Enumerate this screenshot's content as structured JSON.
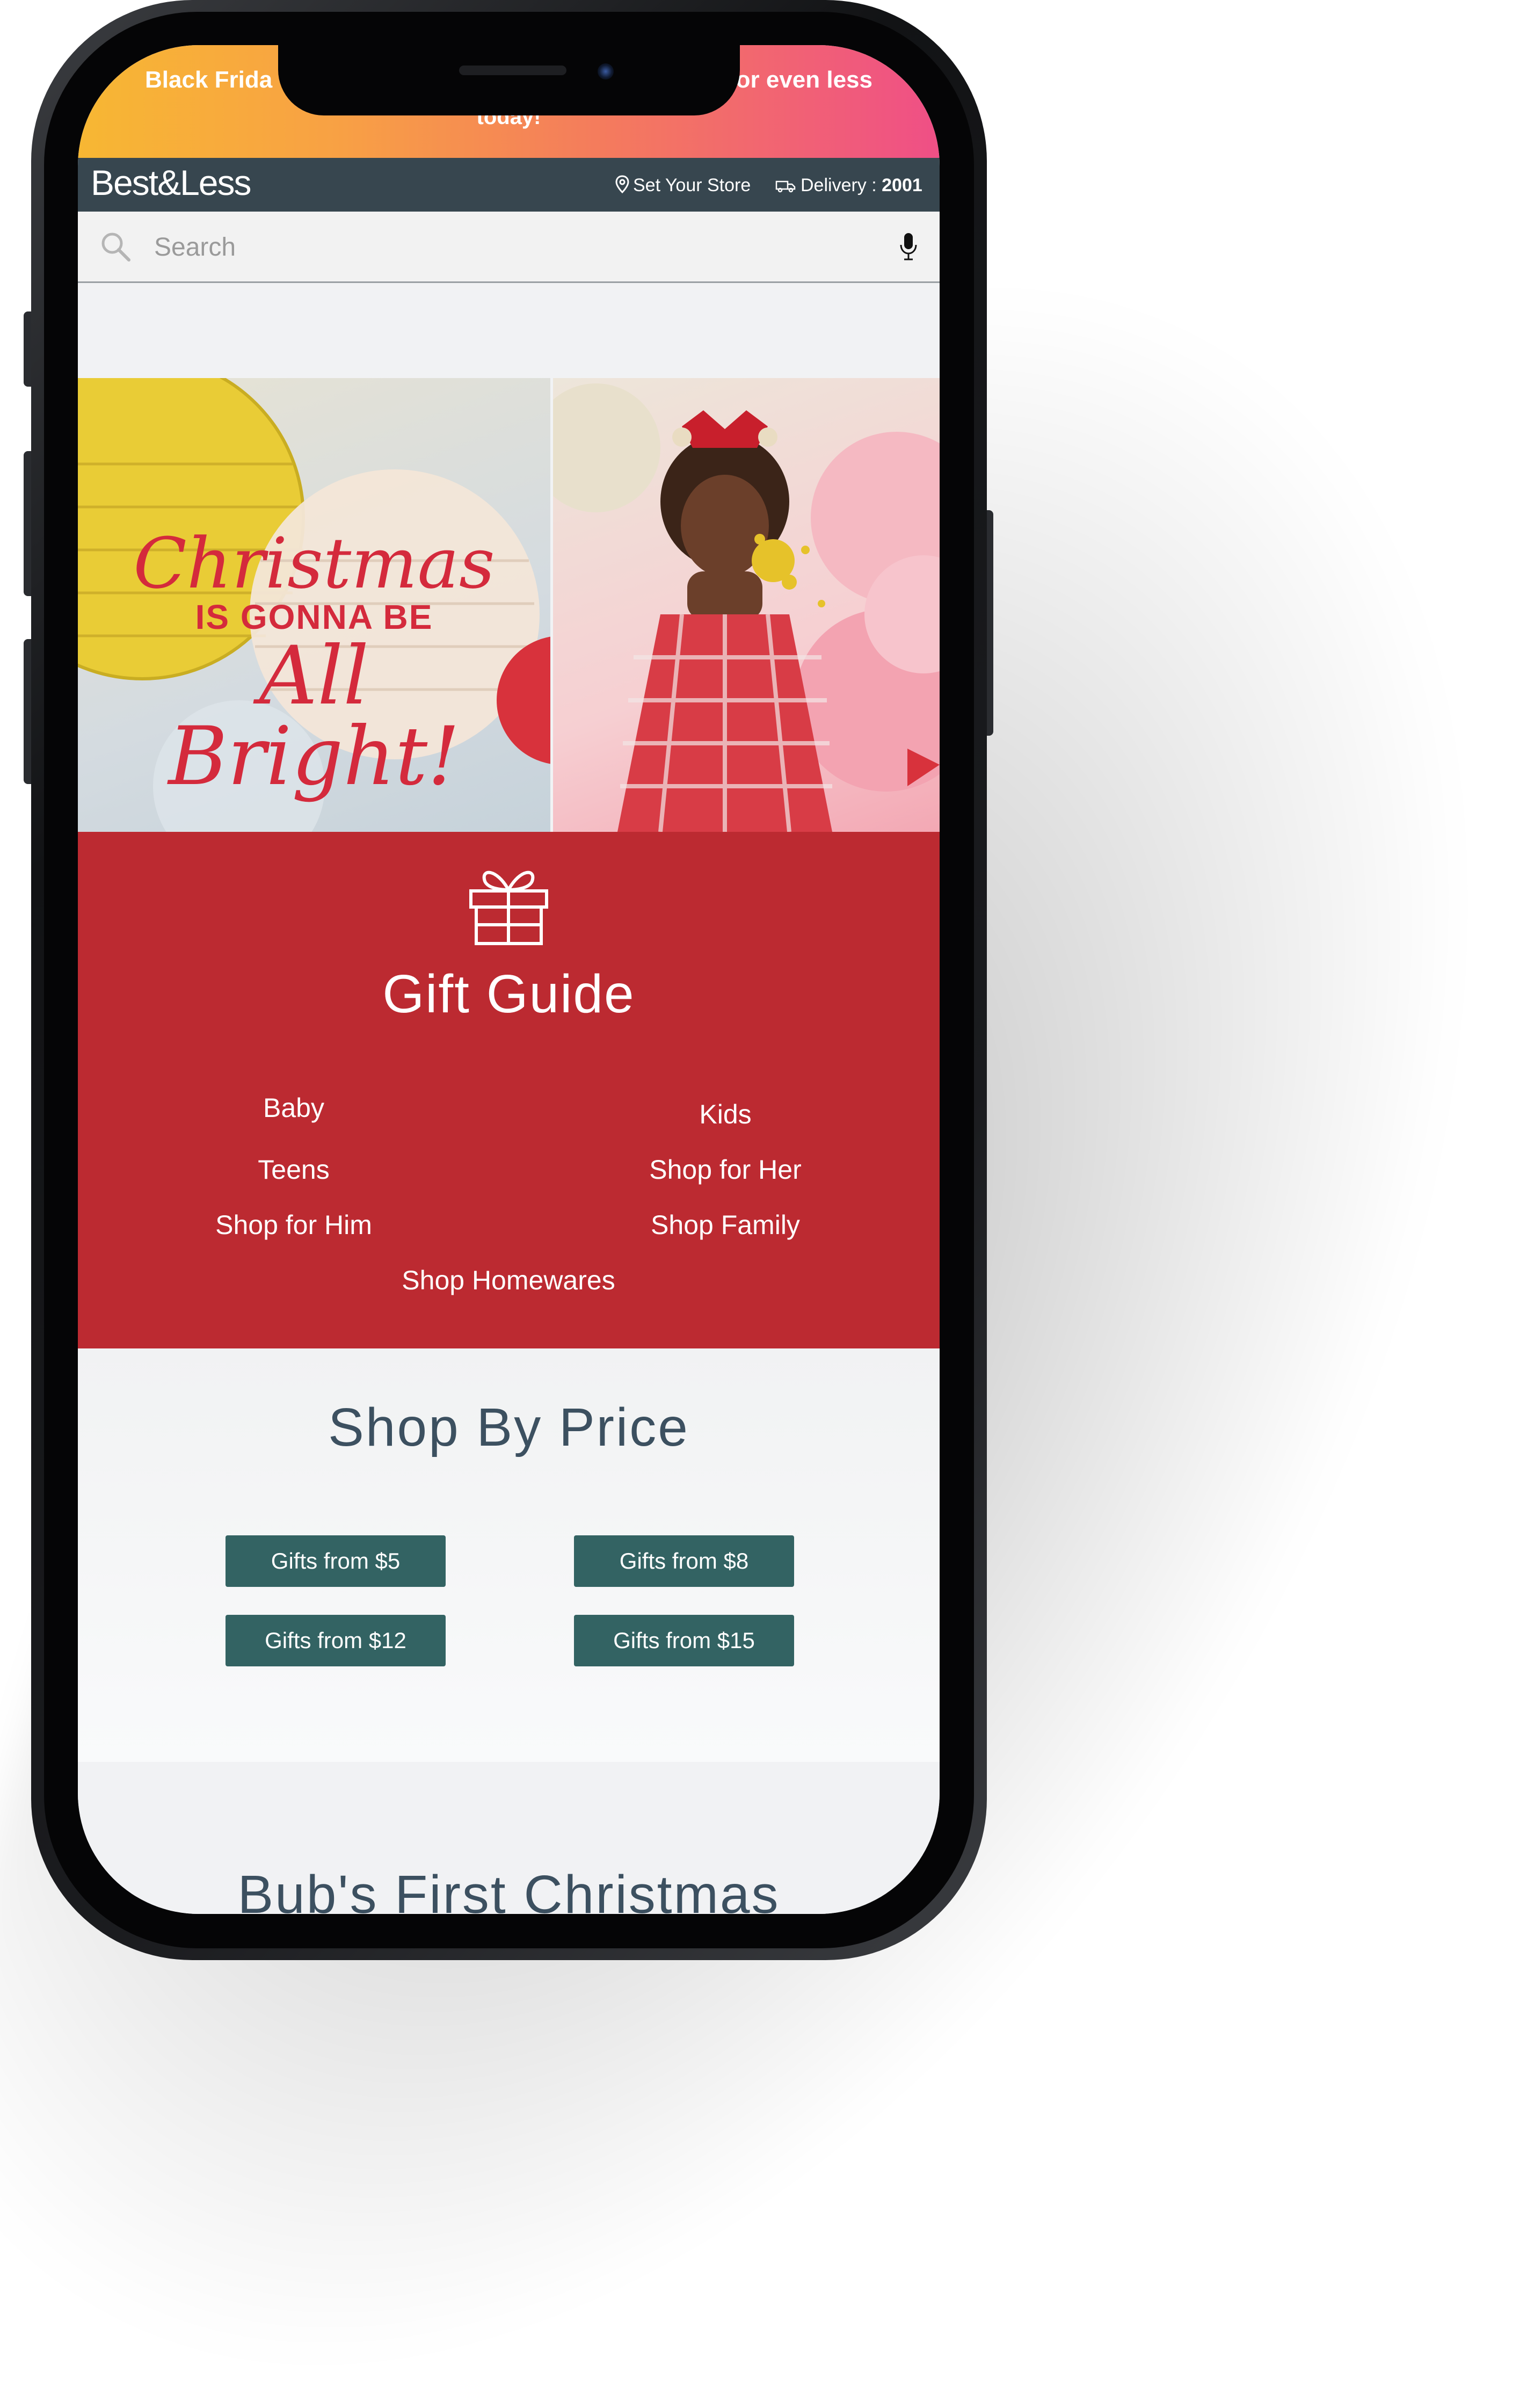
{
  "promo": {
    "left": "Black Frida",
    "right": "or even less",
    "bottom": "today!"
  },
  "header": {
    "logo": "Best&Less",
    "store_label": "Set Your Store",
    "delivery_label": "Delivery : ",
    "delivery_code": "2001"
  },
  "search": {
    "placeholder": "Search"
  },
  "hero": {
    "line1": "Christmas",
    "line2": "IS GONNA BE",
    "line3": "All Bright!"
  },
  "gift_guide": {
    "title": "Gift Guide",
    "links": {
      "baby": "Baby",
      "kids": "Kids",
      "teens": "Teens",
      "her": "Shop for Her",
      "him": "Shop for Him",
      "family": "Shop Family",
      "homewares": "Shop Homewares"
    }
  },
  "shop_by_price": {
    "title": "Shop By Price",
    "buttons": [
      "Gifts from $5",
      "Gifts from $8",
      "Gifts from $12",
      "Gifts from $15"
    ]
  },
  "next_section": {
    "title": "Bub's First Christmas"
  },
  "colors": {
    "header_bg": "#37464f",
    "gift_bg": "#bc2a31",
    "price_button": "#336363",
    "heading_text": "#3c5060"
  }
}
